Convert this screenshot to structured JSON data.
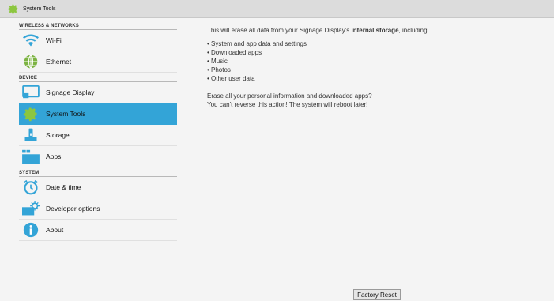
{
  "window": {
    "title": "System Tools"
  },
  "sidebar": {
    "sections": [
      {
        "header": "WIRELESS & NETWORKS"
      },
      {
        "header": "DEVICE"
      },
      {
        "header": "SYSTEM"
      }
    ],
    "items": [
      {
        "label": "Wi-Fi",
        "icon": "wifi-icon"
      },
      {
        "label": "Ethernet",
        "icon": "ethernet-icon"
      },
      {
        "label": "Signage Display",
        "icon": "display-icon"
      },
      {
        "label": "System Tools",
        "icon": "gear-icon",
        "selected": true
      },
      {
        "label": "Storage",
        "icon": "storage-icon"
      },
      {
        "label": "Apps",
        "icon": "apps-icon"
      },
      {
        "label": "Date & time",
        "icon": "clock-icon"
      },
      {
        "label": "Developer options",
        "icon": "developer-icon"
      },
      {
        "label": "About",
        "icon": "info-icon"
      }
    ]
  },
  "content": {
    "intro_prefix": "This will erase all data from your Signage Display's ",
    "intro_bold": "internal storage",
    "intro_suffix": ", including:",
    "bullets": [
      "• System and app data and settings",
      "• Downloaded apps",
      "• Music",
      "• Photos",
      "• Other user data"
    ],
    "warning_line1": "Erase all your personal information and downloaded apps?",
    "warning_line2": "You can't reverse this action! The system will reboot later!"
  },
  "actions": {
    "factory_reset": "Factory Reset"
  },
  "colors": {
    "accent": "#33a4d7",
    "topbar": "#dcdcdc",
    "background": "#f4f4f4"
  }
}
